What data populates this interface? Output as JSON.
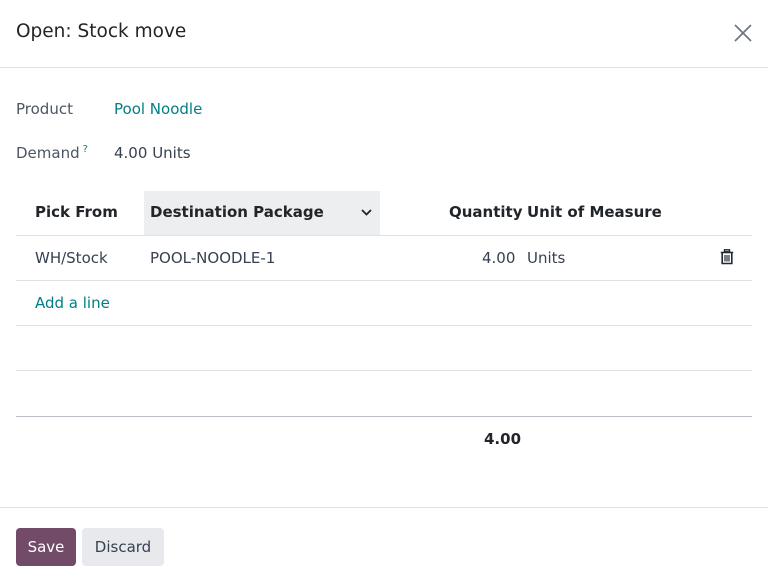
{
  "dialog": {
    "title": "Open: Stock move",
    "close_icon": "close-icon"
  },
  "fields": {
    "product_label": "Product",
    "product_value": "Pool Noodle",
    "demand_label": "Demand",
    "demand_help": "?",
    "demand_value": "4.00",
    "demand_uom": "Units"
  },
  "table": {
    "headers": {
      "pick_from": "Pick From",
      "destination_package": "Destination Package",
      "quantity": "Quantity",
      "uom": "Unit of Measure"
    },
    "rows": [
      {
        "pick_from": "WH/Stock",
        "destination_package": "POOL-NOODLE-1",
        "quantity": "4.00",
        "uom": "Units"
      }
    ],
    "add_line_label": "Add a line",
    "total_quantity": "4.00"
  },
  "footer": {
    "save_label": "Save",
    "discard_label": "Discard"
  },
  "colors": {
    "primary": "#714b67",
    "link": "#017e84"
  }
}
